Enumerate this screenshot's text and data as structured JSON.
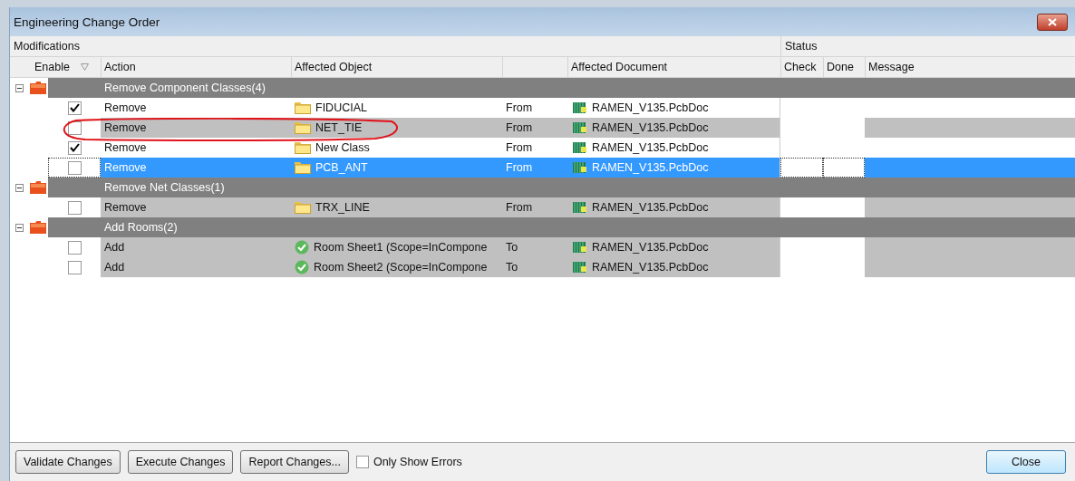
{
  "window": {
    "title": "Engineering Change Order"
  },
  "table": {
    "bands": [
      {
        "label": "Modifications"
      },
      {
        "label": "Status"
      }
    ],
    "columns": [
      "Enable",
      "Action",
      "Affected Object",
      "Affected Document",
      "Check",
      "Done",
      "Message"
    ],
    "groups": [
      {
        "title": "Remove Component Classes(4)",
        "expanded": true,
        "rows": [
          {
            "kind": "folder",
            "enabled": true,
            "selected": false,
            "action": "Remove",
            "object": "FIDUCIAL",
            "direction": "From",
            "document": "RAMEN_V135.PcbDoc"
          },
          {
            "kind": "folder",
            "enabled": false,
            "selected": false,
            "action": "Remove",
            "object": "NET_TIE",
            "direction": "From",
            "document": "RAMEN_V135.PcbDoc"
          },
          {
            "kind": "folder",
            "enabled": true,
            "selected": false,
            "action": "Remove",
            "object": "New Class",
            "direction": "From",
            "document": "RAMEN_V135.PcbDoc"
          },
          {
            "kind": "folder",
            "enabled": false,
            "selected": true,
            "action": "Remove",
            "object": "PCB_ANT",
            "direction": "From",
            "document": "RAMEN_V135.PcbDoc"
          }
        ]
      },
      {
        "title": "Remove Net Classes(1)",
        "expanded": true,
        "rows": [
          {
            "kind": "folder",
            "enabled": false,
            "selected": false,
            "action": "Remove",
            "object": "TRX_LINE",
            "direction": "From",
            "document": "RAMEN_V135.PcbDoc"
          }
        ]
      },
      {
        "title": "Add Rooms(2)",
        "expanded": true,
        "rows": [
          {
            "kind": "room",
            "enabled": false,
            "selected": false,
            "action": "Add",
            "object": "Room Sheet1 (Scope=InCompone",
            "direction": "To",
            "document": "RAMEN_V135.PcbDoc"
          },
          {
            "kind": "room",
            "enabled": false,
            "selected": false,
            "action": "Add",
            "object": "Room Sheet2 (Scope=InCompone",
            "direction": "To",
            "document": "RAMEN_V135.PcbDoc"
          }
        ]
      }
    ]
  },
  "buttons": [
    {
      "label": "Validate Changes"
    },
    {
      "label": "Execute Changes"
    },
    {
      "label": "Report Changes..."
    }
  ],
  "only_show_errors": {
    "label": "Only Show Errors",
    "checked": false
  },
  "close_button": {
    "label": "Close"
  }
}
